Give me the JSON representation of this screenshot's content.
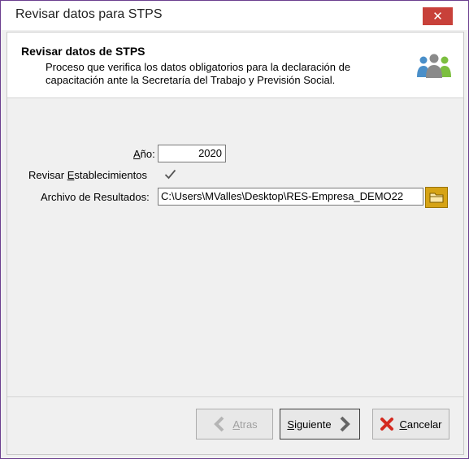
{
  "window": {
    "title": "Revisar datos para STPS",
    "close_glyph": "✕"
  },
  "header": {
    "title": "Revisar datos de STPS",
    "description": "Proceso que verifica los datos obligatorios para la declaración de capacitación ante la Secretaría del Trabajo y Previsión Social.",
    "icon": "people-group-icon"
  },
  "form": {
    "year": {
      "label_mnemonic": "A",
      "label_rest": "ño:",
      "value": "2020"
    },
    "establishments": {
      "label_pre": "Revisar ",
      "label_mnemonic": "E",
      "label_rest": "stablecimientos",
      "checked": true
    },
    "results_file": {
      "label": "Archivo de Resultados:",
      "value": "C:\\Users\\MValles\\Desktop\\RES-Empresa_DEMO22"
    }
  },
  "buttons": {
    "back": {
      "mnemonic": "A",
      "rest": "tras",
      "enabled": false
    },
    "next": {
      "mnemonic": "S",
      "rest": "iguiente",
      "enabled": true
    },
    "cancel": {
      "mnemonic": "C",
      "rest": "ancelar",
      "enabled": true
    }
  },
  "colors": {
    "close": "#c8413a",
    "folder": "#d6a315",
    "cancel_x": "#d42a20",
    "window_border": "#6b3f8f"
  }
}
